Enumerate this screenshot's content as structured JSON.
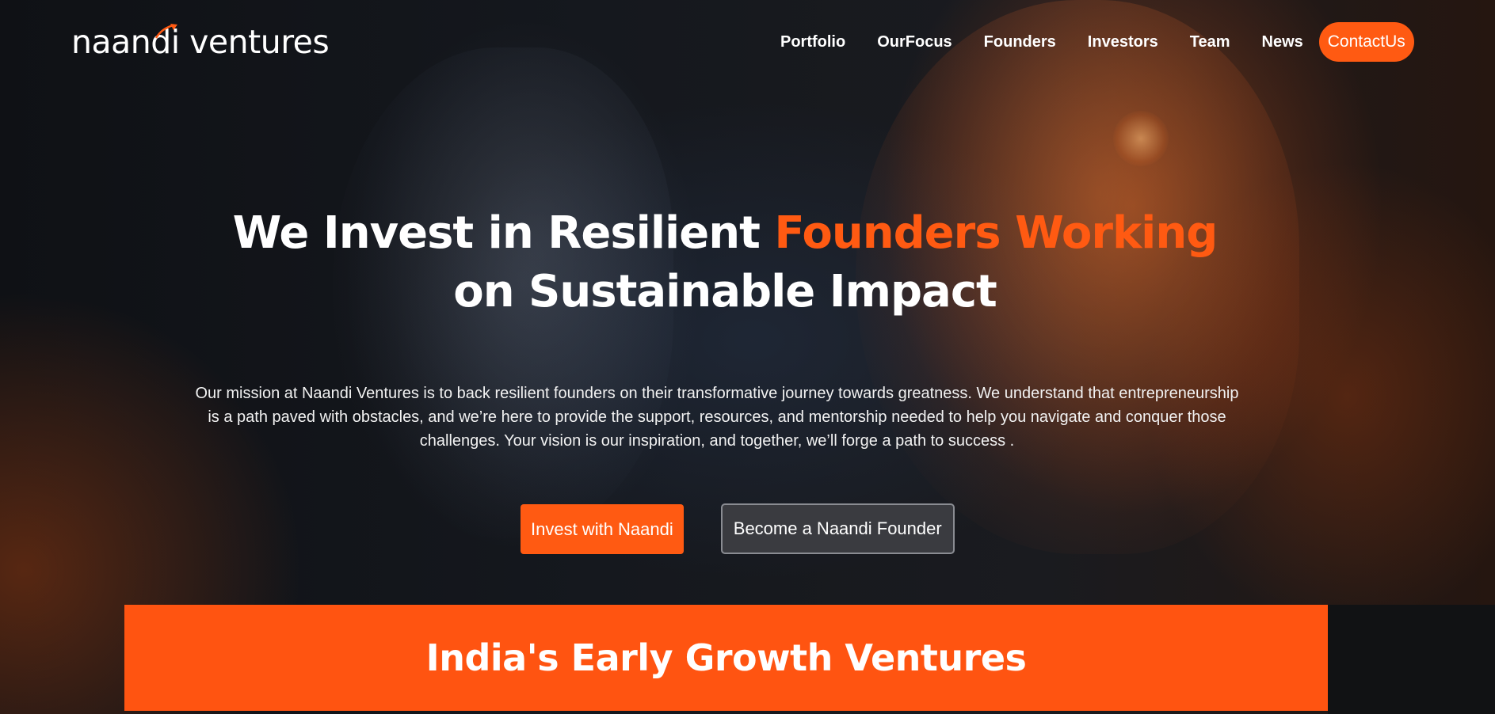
{
  "brand": {
    "logo_text": "naandi ventures",
    "accent_color": "#ff5a12"
  },
  "nav": {
    "links": [
      "Portfolio",
      "OurFocus",
      "Founders",
      "Investors",
      "Team",
      "News"
    ],
    "contact_label": "ContactUs"
  },
  "hero": {
    "title_part1": "We Invest in Resilient ",
    "title_highlight": "Founders Working",
    "title_part2": "on Sustainable Impact",
    "mission": "Our mission at Naandi Ventures is to back resilient founders on their transformative journey towards greatness. We understand that entrepreneurship is a path paved with obstacles, and we’re here to provide the support, resources, and mentorship needed to help you navigate and conquer those challenges. Your vision is our inspiration, and together, we’ll forge a path to success .",
    "invest_button": "Invest with Naandi",
    "founder_button": "Become a Naandi Founder"
  },
  "banner": {
    "title": "India's Early Growth Ventures"
  },
  "icons": {
    "logo_mark": "rocket-icon"
  }
}
